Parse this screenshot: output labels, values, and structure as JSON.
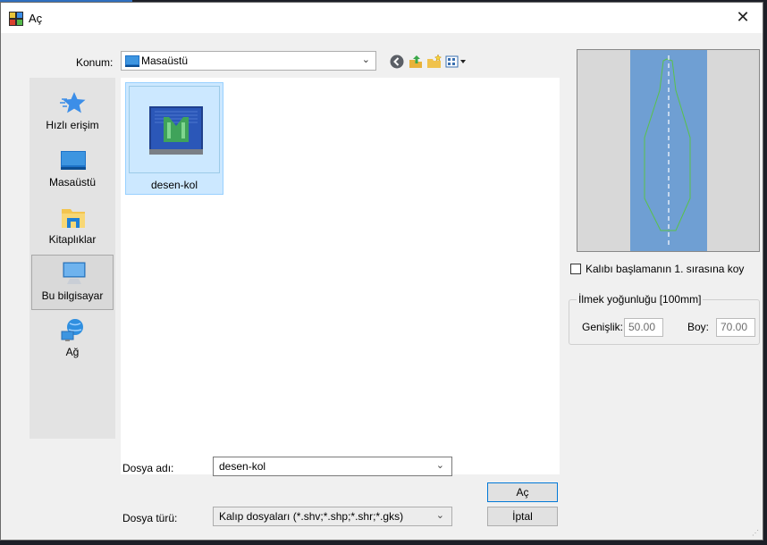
{
  "window": {
    "title": "Aç",
    "close_glyph": "✕"
  },
  "location": {
    "label": "Konum:",
    "value": "Masaüstü",
    "icon": "desktop-icon"
  },
  "toolbar": {
    "icons": [
      "back-icon",
      "up-folder-icon",
      "new-folder-icon",
      "view-menu-icon"
    ]
  },
  "places": [
    {
      "label": "Hızlı erişim",
      "icon": "star-icon",
      "selected": false
    },
    {
      "label": "Masaüstü",
      "icon": "desktop-icon",
      "selected": false
    },
    {
      "label": "Kitaplıklar",
      "icon": "libraries-icon",
      "selected": false
    },
    {
      "label": "Bu bilgisayar",
      "icon": "computer-icon",
      "selected": true
    },
    {
      "label": "Ağ",
      "icon": "network-icon",
      "selected": false
    }
  ],
  "files": [
    {
      "name": "desen-kol",
      "selected": true
    }
  ],
  "form": {
    "filename_label": "Dosya adı:",
    "filename_value": "desen-kol",
    "filetype_label": "Dosya türü:",
    "filetype_value": "Kalıp dosyaları (*.shv;*.shp;*.shr;*.gks)",
    "open_button": "Aç",
    "cancel_button": "İptal"
  },
  "options": {
    "checkbox_label": "Kalıbı başlamanın 1. sırasına koy",
    "checkbox_checked": false,
    "density_group": "İlmek yoğunluğu [100mm]",
    "width_label": "Genişlik:",
    "width_value": "50.00",
    "height_label": "Boy:",
    "height_value": "70.00"
  },
  "colors": {
    "accent": "#0078d7",
    "selection_bg": "#cce8ff",
    "preview_band": "#6f9fd3",
    "preview_outline": "#59c24a"
  }
}
